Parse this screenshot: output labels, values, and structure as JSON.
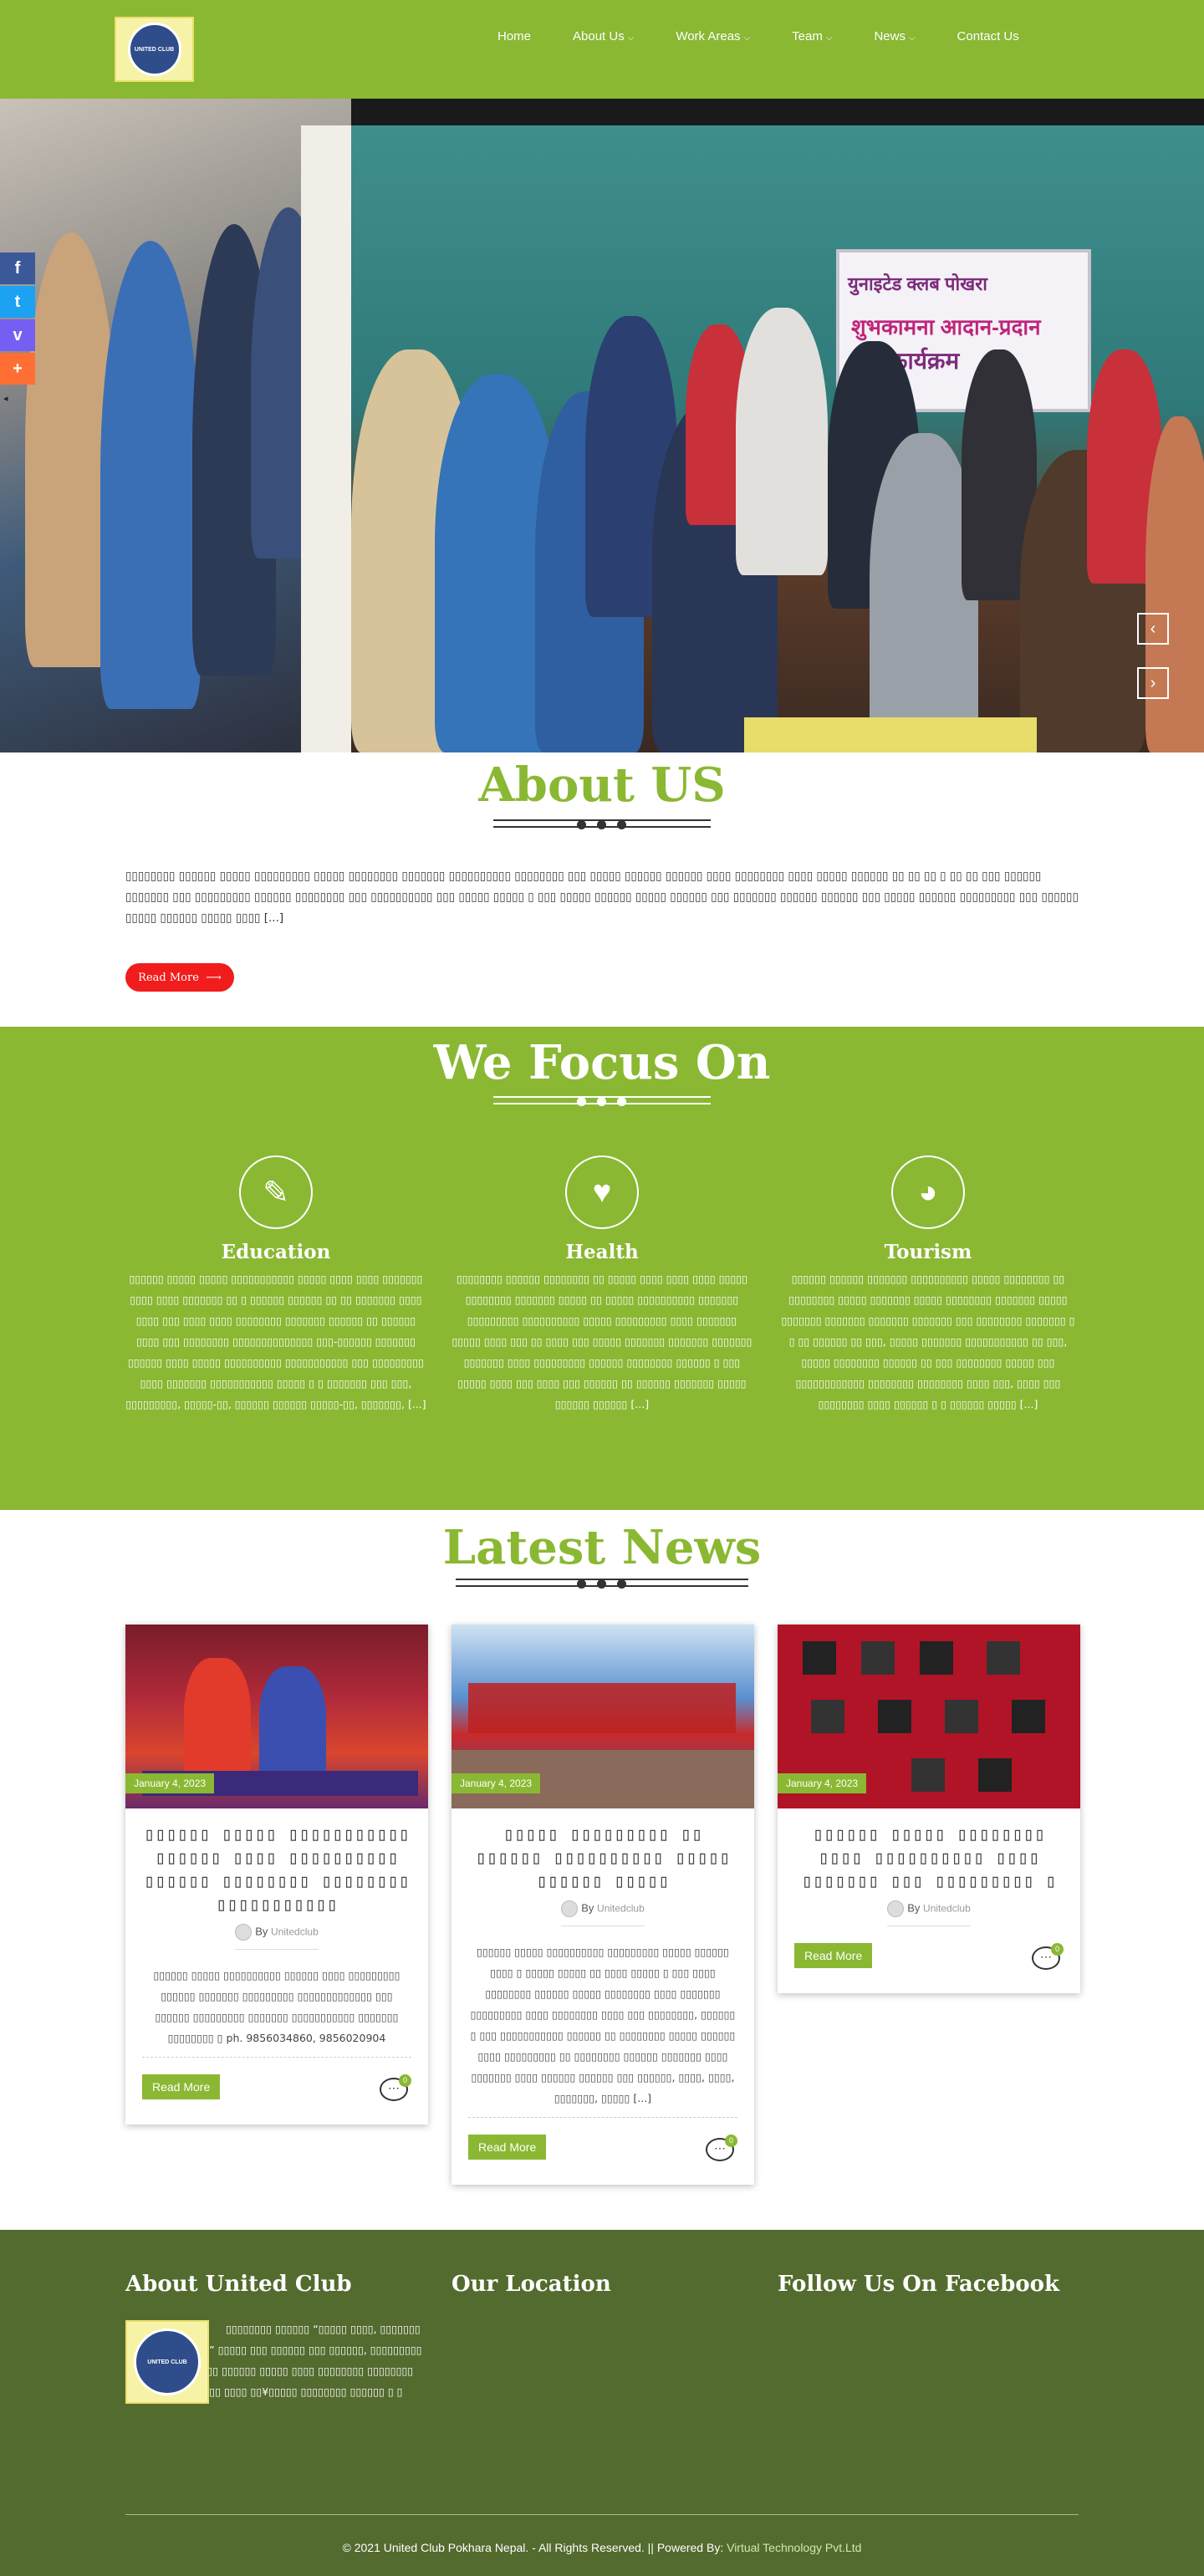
{
  "header": {
    "logo_text": "UNITED CLUB",
    "nav": [
      {
        "label": "Home",
        "dropdown": false
      },
      {
        "label": "About Us",
        "dropdown": true
      },
      {
        "label": "Work Areas",
        "dropdown": true
      },
      {
        "label": "Team",
        "dropdown": true
      },
      {
        "label": "News",
        "dropdown": true
      },
      {
        "label": "Contact Us",
        "dropdown": false
      }
    ]
  },
  "hero": {
    "banner_line1": "युनाइटेड क्लब पोखरा",
    "banner_line2": "शुभकामना आदान-प्रदान",
    "banner_line3": "कार्यक्रम",
    "prev_icon": "chevron-left-icon",
    "next_icon": "chevron-right-icon",
    "prev_glyph": "‹",
    "next_glyph": "›"
  },
  "share": {
    "facebook": "f",
    "twitter": "t",
    "viber": "v",
    "add": "+",
    "toggle": "◂"
  },
  "about": {
    "title": "About US",
    "text": "▯▯▯▯▯▯▯▯ ▯▯▯▯▯▯ ▯▯▯▯▯ ▯▯▯▯▯▯▯▯▯ ▯▯▯▯▯ ▯▯▯▯▯▯▯▯ ▯▯▯▯▯▯▯ ▯▯▯▯▯▯▯▯▯▯ ▯▯▯▯▯▯▯▯ ▯▯▯ ▯▯▯▯▯ ▯▯▯▯▯▯ ▯▯▯▯▯▯ ▯▯▯▯ ▯▯▯▯▯▯▯▯ ▯▯▯▯ ▯▯▯▯▯ ▯▯▯▯▯▯ ▯▯ ▯▯ ▯▯ ▯ ▯▯ ▯▯ ▯▯▯ ▯▯▯▯▯▯ ▯▯▯▯▯▯▯ ▯▯▯ ▯▯▯▯▯▯▯▯▯ ▯▯▯▯▯▯ ▯▯▯▯▯▯▯▯ ▯▯▯ ▯▯▯▯▯▯▯▯▯▯ ▯▯▯ ▯▯▯▯▯ ▯▯▯▯▯ ▯ ▯▯▯ ▯▯▯▯▯ ▯▯▯▯▯▯ ▯▯▯▯▯ ▯▯▯▯▯▯ ▯▯▯ ▯▯▯▯▯▯▯ ▯▯▯▯▯▯ ▯▯▯▯▯▯ ▯▯▯ ▯▯▯▯▯ ▯▯▯▯▯▯ ▯▯▯▯▯▯▯▯▯ ▯▯▯ ▯▯▯▯▯▯ ▯▯▯▯▯ ▯▯▯▯▯▯ ▯▯▯▯▯ ▯▯▯▯ [...]",
    "button": "Read More",
    "button_icon": "arrow-right-icon"
  },
  "focus": {
    "title": "We Focus On",
    "items": [
      {
        "name": "Education",
        "icon": "pencil-icon",
        "glyph": "✎",
        "text": "▯▯▯▯▯▯ ▯▯▯▯▯ ▯▯▯▯▯ ▯▯▯▯▯▯▯▯▯▯▯ ▯▯▯▯▯ ▯▯▯▯ ▯▯▯▯ ▯▯▯▯▯▯▯ ▯▯▯▯ ▯▯▯▯ ▯▯▯▯▯▯▯ ▯▯ ▯ ▯▯▯▯▯▯ ▯▯▯▯▯▯ ▯▯ ▯▯ ▯▯▯▯▯▯▯ ▯▯▯▯ ▯▯▯▯ ▯▯▯ ▯▯▯▯ ▯▯▯▯ ▯▯▯▯▯▯▯▯ ▯▯▯▯▯▯▯ ▯▯▯▯▯▯ ▯▯ ▯▯▯▯▯▯ ▯▯▯▯ ▯▯▯ ▯▯▯▯▯▯▯▯ ▯▯▯▯▯▯▯▯▯▯▯▯▯▯ ▯▯▯-▯▯▯▯▯▯ ▯▯▯▯▯▯▯ ▯▯▯▯▯▯ ▯▯▯▯ ▯▯▯▯▯ ▯▯▯▯▯▯▯▯▯▯ ▯▯▯▯▯▯▯▯▯▯▯ ▯▯▯ ▯▯▯▯▯▯▯▯▯ ▯▯▯▯ ▯▯▯▯▯▯▯ ▯▯▯▯▯▯▯▯▯▯▯ ▯▯▯▯▯ ▯ ▯ ▯▯▯▯▯▯▯ ▯▯▯ ▯▯▯, ▯▯▯▯▯▯▯▯▯, ▯▯▯▯▯-▯▯, ▯▯▯▯▯▯ ▯▯▯▯▯▯ ▯▯▯▯▯-▯▯, ▯▯▯▯▯▯▯, [...]"
      },
      {
        "name": "Health",
        "icon": "heart-icon",
        "glyph": "♥",
        "text": "▯▯▯▯▯▯▯▯ ▯▯▯▯▯▯ ▯▯▯▯▯▯▯▯ ▯▯ ▯▯▯▯▯ ▯▯▯▯ ▯▯▯▯ ▯▯▯▯ ▯▯▯▯▯ ▯▯▯▯▯▯▯▯ ▯▯▯▯▯▯▯ ▯▯▯▯▯ ▯▯ ▯▯▯▯▯ ▯▯▯▯▯▯▯▯▯▯ ▯▯▯▯▯▯▯ ▯▯▯▯▯▯▯▯▯ ▯▯▯▯▯▯▯▯▯▯ ▯▯▯▯▯ ▯▯▯▯▯▯▯▯▯ ▯▯▯▯ ▯▯▯▯▯▯▯ ▯▯▯▯▯ ▯▯▯▯ ▯▯▯ ▯▯ ▯▯▯▯ ▯▯▯ ▯▯▯▯▯ ▯▯▯▯▯▯▯ ▯▯▯▯▯▯▯ ▯▯▯▯▯▯▯ ▯▯▯▯▯▯▯ ▯▯▯▯ ▯▯▯▯▯▯▯▯▯ ▯▯▯▯▯▯ ▯▯▯▯▯▯▯▯ ▯▯▯▯▯▯ ▯ ▯▯▯ ▯▯▯▯▯ ▯▯▯▯ ▯▯▯ ▯▯▯▯ ▯▯▯ ▯▯▯▯▯▯ ▯▯ ▯▯▯▯▯▯ ▯▯▯▯▯▯▯ ▯▯▯▯▯ ▯▯▯▯▯▯ ▯▯▯▯▯▯ [...]"
      },
      {
        "name": "Tourism",
        "icon": "globe-icon",
        "glyph": "◕",
        "text": "▯▯▯▯▯▯ ▯▯▯▯▯▯ ▯▯▯▯▯▯▯ ▯▯▯▯▯▯▯▯▯▯ ▯▯▯▯▯ ▯▯▯▯▯▯▯▯ ▯▯ ▯▯▯▯▯▯▯▯ ▯▯▯▯▯ ▯▯▯▯▯▯▯ ▯▯▯▯▯ ▯▯▯▯▯▯▯▯ ▯▯▯▯▯▯▯ ▯▯▯▯▯ ▯▯▯▯▯▯▯ ▯▯▯▯▯▯▯ ▯▯▯▯▯▯▯ ▯▯▯▯▯▯▯ ▯▯▯ ▯▯▯▯▯▯▯▯ ▯▯▯▯▯▯▯ ▯ ▯ ▯▯ ▯▯▯▯▯▯ ▯▯ ▯▯▯, ▯▯▯▯▯ ▯▯▯▯▯▯▯ ▯▯▯▯▯▯▯▯▯▯▯ ▯▯ ▯▯▯, ▯▯▯▯▯ ▯▯▯▯▯▯▯▯ ▯▯▯▯▯▯ ▯▯ ▯▯▯ ▯▯▯▯▯▯▯▯ ▯▯▯▯▯ ▯▯▯ ▯▯▯▯▯▯▯▯▯▯▯▯ ▯▯▯▯▯▯▯▯ ▯▯▯▯▯▯▯▯ ▯▯▯▯ ▯▯▯, ▯▯▯▯ ▯▯▯ ▯▯▯▯▯▯▯▯ ▯▯▯▯ ▯▯▯▯▯▯ ▯ ▯ ▯▯▯▯▯▯ ▯▯▯▯▯ [...]"
      }
    ]
  },
  "news": {
    "title": "Latest News",
    "by_label": "By",
    "read_more": "Read More",
    "cards": [
      {
        "date": "January 4, 2023",
        "title": "▯▯▯▯▯▯ ▯▯▯▯▯ ▯▯▯▯▯▯▯▯▯▯▯ ▯▯▯▯▯▯ ▯▯▯▯ ▯▯▯▯▯▯▯▯▯▯ ▯▯▯▯▯▯ ▯▯▯▯▯▯▯▯ ▯▯▯▯▯▯▯▯ ▯▯▯▯▯▯▯▯▯▯▯",
        "author": "Unitedclub",
        "excerpt": "▯▯▯▯▯▯ ▯▯▯▯▯ ▯▯▯▯▯▯▯▯▯▯ ▯▯▯▯▯▯ ▯▯▯▯ ▯▯▯▯▯▯▯▯▯ ▯▯▯▯▯▯ ▯▯▯▯▯▯▯ ▯▯▯▯▯▯▯▯▯ ▯▯▯▯▯▯▯▯▯▯▯▯▯ ▯▯▯ ▯▯▯▯▯▯ ▯▯▯▯▯▯▯▯▯ ▯▯▯▯▯▯▯ ▯▯▯▯▯▯▯▯▯▯▯ ▯▯▯▯▯▯▯ ▯▯▯▯▯▯▯▯ ▯ ph. 9856034860, 9856020904",
        "comments": "0",
        "image_kind": "dance"
      },
      {
        "date": "January 4, 2023",
        "title": "▯▯▯▯▯ ▯▯▯▯▯▯▯▯▯ ▯▯ ▯▯▯▯▯▯ ▯▯▯▯▯▯▯▯▯▯ ▯▯▯▯▯ ▯▯▯▯▯▯ ▯▯▯▯▯",
        "author": "Unitedclub",
        "excerpt": "▯▯▯▯▯▯ ▯▯▯▯▯ ▯▯▯▯▯▯▯▯▯▯ ▯▯▯▯▯▯▯▯▯ ▯▯▯▯▯ ▯▯▯▯▯▯ ▯▯▯▯ ▯ ▯▯▯▯▯ ▯▯▯▯▯ ▯▯ ▯▯▯▯ ▯▯▯▯▯ ▯ ▯▯▯ ▯▯▯▯ ▯▯▯▯▯▯▯▯ ▯▯▯▯▯▯ ▯▯▯▯▯ ▯▯▯▯▯▯▯▯ ▯▯▯▯ ▯▯▯▯▯▯▯ ▯▯▯▯▯▯▯▯▯ ▯▯▯▯ ▯▯▯▯▯▯▯▯ ▯▯▯▯ ▯▯▯ ▯▯▯▯▯▯▯▯, ▯▯▯▯▯▯ ▯ ▯▯▯ ▯▯▯▯▯▯▯▯▯▯▯ ▯▯▯▯▯▯ ▯▯ ▯▯▯▯▯▯▯▯ ▯▯▯▯▯ ▯▯▯▯▯▯ ▯▯▯▯ ▯▯▯▯▯▯▯▯▯ ▯▯ ▯▯▯▯▯▯▯▯ ▯▯▯▯▯▯ ▯▯▯▯▯▯▯ ▯▯▯▯ ▯▯▯▯▯▯▯ ▯▯▯▯ ▯▯▯▯▯▯ ▯▯▯▯▯▯ ▯▯▯ ▯▯▯▯▯▯, ▯▯▯▯, ▯▯▯▯, ▯▯▯▯▯▯▯, ▯▯▯▯▯ [...]",
        "comments": "0",
        "image_kind": "festival"
      },
      {
        "date": "January 4, 2023",
        "title": "▯▯▯▯▯▯ ▯▯▯▯▯ ▯▯▯▯▯▯▯▯ ▯▯▯▯ ▯▯▯▯▯▯▯▯▯▯ ▯▯▯▯ ▯▯▯▯▯▯▯ ▯▯▯ ▯▯▯▯▯▯▯▯▯ ▯",
        "author": "Unitedclub",
        "excerpt": "",
        "comments": "0",
        "image_kind": "singers"
      }
    ]
  },
  "footer": {
    "about_title": "About United Club",
    "about_text": "▯▯▯▯▯▯▯▯ ▯▯▯▯▯▯ “▯▯▯▯▯ ▯▯▯▯, ▯▯▯▯▯▯▯ ▯▯▯▯▯▯▯▯▯▯ ▯▯▯▯” ▯▯▯▯▯ ▯▯▯ ▯▯▯▯▯▯ ▯▯▯ ▯▯▯▯▯▯, ▯▯▯▯▯▯▯▯▯ ▯ ▯▯▯▯▯▯▯▯▯ ▯▯▯▯▯ ▯▯▯▯▯▯ ▯▯▯▯▯ ▯▯▯▯ ▯▯▯▯▯▯▯▯ ▯▯▯▯▯▯▯▯ ▯▯▯▯▯▯▯ ▯▯▯▯▯▯▯▯▯ ▯▯▯▯ ▯▯¥▯▯▯▯▯ ▯▯▯▯▯▯▯▯ ▯▯▯▯▯▯ ▯ ▯",
    "location_title": "Our Location",
    "facebook_title": "Follow Us On Facebook",
    "copyright": "© 2021 United Club Pokhara Nepal. - All Rights Reserved. || Powered By:",
    "powered_by": "Virtual Technology Pvt.Ltd"
  }
}
